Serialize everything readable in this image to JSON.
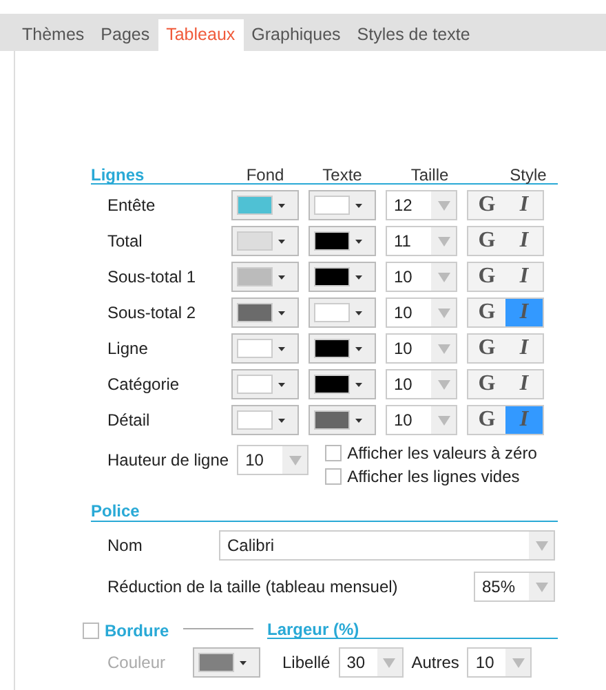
{
  "tabs": [
    {
      "label": "Thèmes",
      "selected": false
    },
    {
      "label": "Pages",
      "selected": false
    },
    {
      "label": "Tableaux",
      "selected": true
    },
    {
      "label": "Graphiques",
      "selected": false
    },
    {
      "label": "Styles de texte",
      "selected": false
    }
  ],
  "lines": {
    "title": "Lignes",
    "columns": [
      "Fond",
      "Texte",
      "Taille",
      "Style"
    ],
    "rows": [
      {
        "label": "Entête",
        "fill": {
          "color": "#4fc1d4"
        },
        "text_fill": {
          "color": "#ffffff"
        },
        "size": "12",
        "bold_label": "G",
        "italic_label": "I",
        "bold": false,
        "italic": false
      },
      {
        "label": "Total",
        "fill": {
          "color": "#dddddd"
        },
        "text_fill": {
          "color": "#000000"
        },
        "size": "11",
        "bold_label": "G",
        "italic_label": "I",
        "bold": false,
        "italic": false
      },
      {
        "label": "Sous-total 1",
        "fill": {
          "color": "#bbbbbb"
        },
        "text_fill": {
          "color": "#000000"
        },
        "size": "10",
        "bold_label": "G",
        "italic_label": "I",
        "bold": false,
        "italic": false
      },
      {
        "label": "Sous-total 2",
        "fill": {
          "color": "#6b6b6b"
        },
        "text_fill": {
          "color": "#ffffff"
        },
        "size": "10",
        "bold_label": "G",
        "italic_label": "I",
        "bold": false,
        "italic": true
      },
      {
        "label": "Ligne",
        "fill": {
          "color": "#ffffff"
        },
        "text_fill": {
          "color": "#000000"
        },
        "size": "10",
        "bold_label": "G",
        "italic_label": "I",
        "bold": false,
        "italic": false
      },
      {
        "label": "Catégorie",
        "fill": {
          "color": "#ffffff"
        },
        "text_fill": {
          "color": "#000000"
        },
        "size": "10",
        "bold_label": "G",
        "italic_label": "I",
        "bold": false,
        "italic": false
      },
      {
        "label": "Détail",
        "fill": {
          "color": "#ffffff"
        },
        "text_fill": {
          "color": "#666666"
        },
        "size": "10",
        "bold_label": "G",
        "italic_label": "I",
        "bold": false,
        "italic": true
      }
    ],
    "row_height": {
      "label": "Hauteur de ligne",
      "value": "10"
    },
    "options": [
      {
        "label": "Afficher les valeurs à zéro",
        "checked": false
      },
      {
        "label": "Afficher les lignes vides",
        "checked": false
      }
    ]
  },
  "font": {
    "title": "Police",
    "name_label": "Nom",
    "name_value": "Calibri",
    "reduction_label": "Réduction de la taille (tableau mensuel)",
    "reduction_value": "85%"
  },
  "border": {
    "title": "Bordure",
    "checked": false,
    "color_label": "Couleur",
    "color": "#808080"
  },
  "width": {
    "title": "Largeur (%)",
    "label_label": "Libellé",
    "label_value": "30",
    "others_label": "Autres",
    "others_value": "10"
  }
}
